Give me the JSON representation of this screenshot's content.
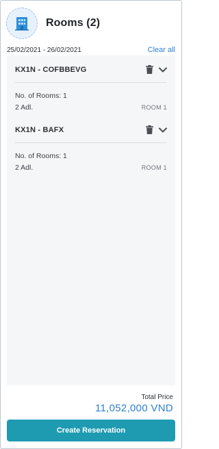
{
  "header": {
    "icon": "hotel-building-icon",
    "title": "Rooms (2)"
  },
  "date_range": "25/02/2021 - 26/02/2021",
  "clear_all_label": "Clear all",
  "rooms": [
    {
      "name": "KX1N - COFBBEVG",
      "rooms_line": "No. of Rooms: 1",
      "guests": "2 Adl.",
      "tag": "ROOM 1"
    },
    {
      "name": "KX1N - BAFX",
      "rooms_line": "No. of Rooms: 1",
      "guests": "2 Adl.",
      "tag": "ROOM 1"
    }
  ],
  "footer": {
    "total_label": "Total Price",
    "total_price": "11,052,000 VND",
    "create_label": "Create Reservation"
  },
  "colors": {
    "accent_blue": "#2f7fd0",
    "button_teal": "#1e9bb1"
  }
}
